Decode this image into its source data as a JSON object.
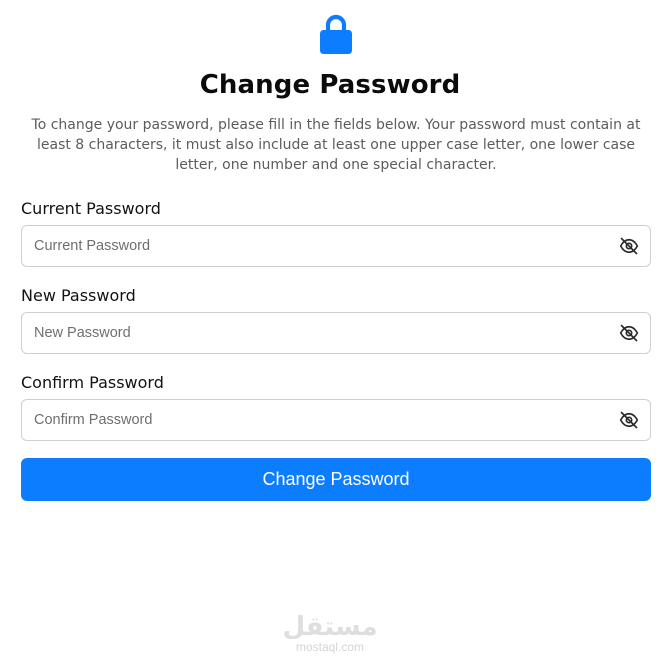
{
  "icon": "lock-icon",
  "accent_color": "#0d7dff",
  "title": "Change Password",
  "description": "To change your password, please fill in the fields below. Your password must contain at least 8 characters, it must also include at least one upper case letter, one lower case letter, one number and one special character.",
  "fields": {
    "current": {
      "label": "Current Password",
      "placeholder": "Current Password",
      "value": "",
      "toggle_icon": "eye-off-icon"
    },
    "new": {
      "label": "New Password",
      "placeholder": "New Password",
      "value": "",
      "toggle_icon": "eye-off-icon"
    },
    "confirm": {
      "label": "Confirm Password",
      "placeholder": "Confirm Password",
      "value": "",
      "toggle_icon": "eye-off-icon"
    }
  },
  "submit_label": "Change Password",
  "watermark": {
    "arabic": "مستقل",
    "latin": "mostaql.com"
  }
}
